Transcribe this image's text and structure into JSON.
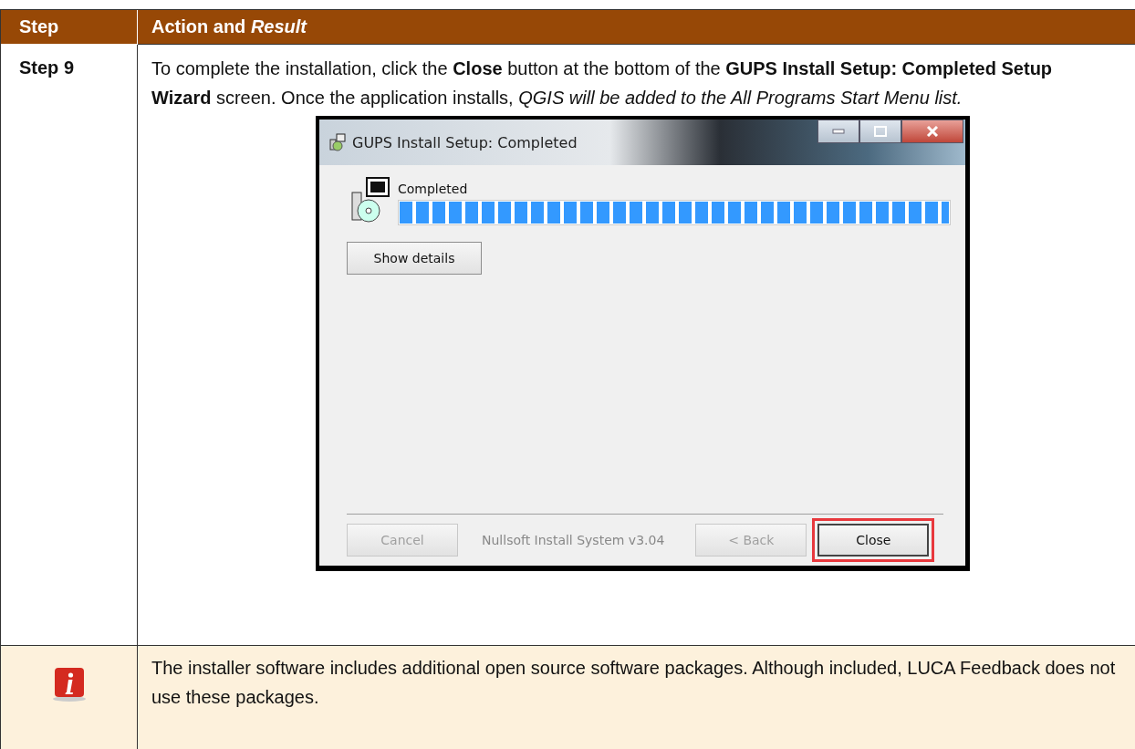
{
  "table": {
    "columns": [
      "Step",
      "Action and *Result*"
    ],
    "step_row": {
      "step": "Step 9",
      "text": "To complete the installation, click the **Close** button at the bottom of the **GUPS Install Setup: Completed Setup Wizard** screen. Once the application installs, *QGIS will be added to the All Programs Start Menu list.*",
      "window": {
        "title": "GUPS Install Setup: Completed",
        "status": "Completed",
        "level": 1,
        "details_button": "Show details",
        "buttons_left": [
          {
            "label": "Cancel",
            "disabled": true,
            "highlighted": false
          }
        ],
        "branding": "Nullsoft Install System v3.04",
        "buttons_right": [
          {
            "label": "< Back",
            "disabled": true,
            "highlighted": false
          },
          {
            "label": "Close",
            "disabled": false,
            "highlighted": true
          }
        ]
      }
    },
    "note_row": {
      "text": "The installer software includes additional open source software packages. Although included, LUCA Feedback does not use these packages."
    }
  }
}
